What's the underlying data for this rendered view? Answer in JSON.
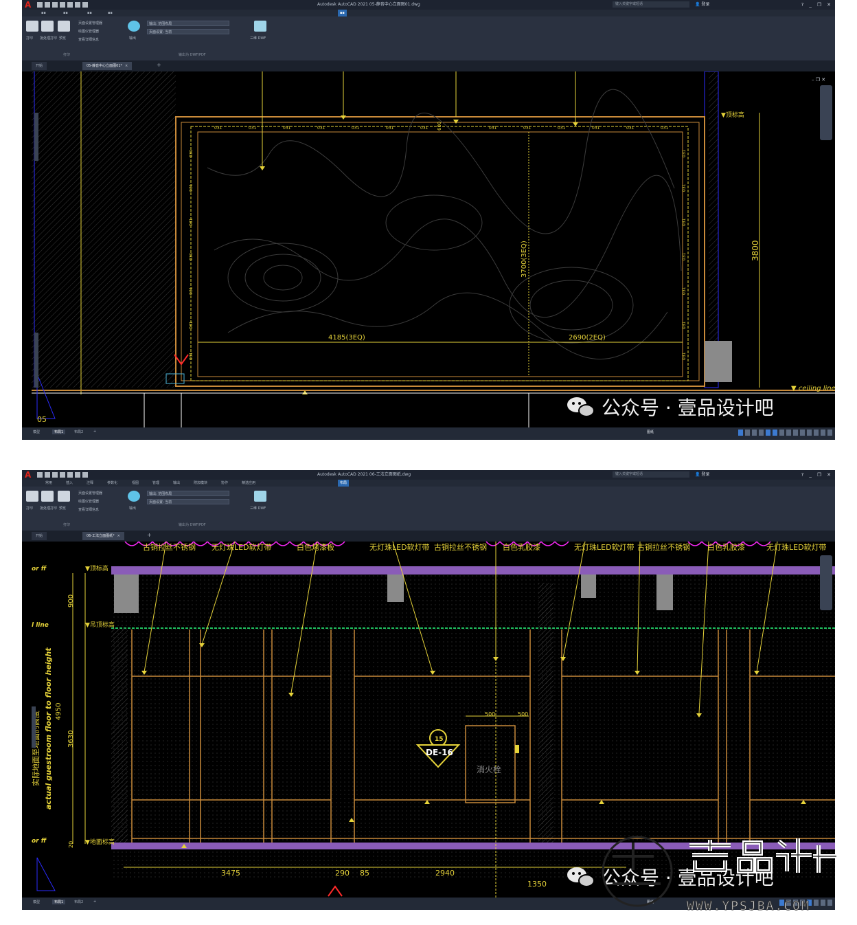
{
  "screens": [
    {
      "app_title": "Autodesk AutoCAD 2021",
      "file_name": "05-静音中心立面图01.dwg",
      "search_placeholder": "键入关键字或短语",
      "login_label": "登录",
      "ribbon": {
        "plot": "打印",
        "batch_plot": "批处理打印",
        "preview": "预览",
        "page_setup_manager": "页面设置管理器",
        "plotter_manager": "绘图仪管理器",
        "view_details": "查看详细信息",
        "group_plot": "打印",
        "export": "输出",
        "export_value": "输出: 范围布局",
        "page_setup_value": "页面设置: 当前",
        "export_group": "输出为 DWF/PDF",
        "dwf_3d": "三维 DWF"
      },
      "doc_tabs": [
        "开始",
        "05-静音中心立面图01*"
      ],
      "status_tabs": [
        "模型",
        "布局1",
        "布局2"
      ],
      "status_model_label": "图纸",
      "drawing": {
        "dim_label_a": "4185(3EQ)",
        "dim_label_b": "2690(2EQ)",
        "dim_label_height": "3700(3EQ)",
        "dim_total_height": "3800",
        "spacing_label": "600",
        "bay_count": "05",
        "ceiling_line_label": "ceiling line",
        "level_label": "▼顶标高"
      },
      "watermark": "公众号 · 壹品设计吧"
    },
    {
      "app_title": "Autodesk AutoCAD 2021",
      "file_name": "06-工法立面图纸.dwg",
      "search_placeholder": "键入关键字或短语",
      "login_label": "登录",
      "menu_items": [
        "常用",
        "插入",
        "注释",
        "参数化",
        "视图",
        "管理",
        "输出",
        "附加模块",
        "协作",
        "精选应用",
        "布局"
      ],
      "ribbon": {
        "plot": "打印",
        "batch_plot": "批处理打印",
        "preview": "预览",
        "page_setup_manager": "页面设置管理器",
        "plotter_manager": "绘图仪管理器",
        "view_details": "查看详细信息",
        "group_plot": "打印",
        "export": "输出",
        "export_value": "输出: 范围布局",
        "page_setup_value": "页面设置: 当前",
        "export_group": "输出为 DWF/PDF",
        "dwf_3d": "三维 DWF"
      },
      "doc_tabs": [
        "开始",
        "06-工法立面图纸*"
      ],
      "status_tabs": [
        "模型",
        "布局1",
        "布局2"
      ],
      "status_model_label": "图纸",
      "drawing": {
        "material_labels": [
          "古铜拉丝不锈钢",
          "无灯珠LED软灯带",
          "白色烤漆板",
          "无灯珠LED软灯带",
          "古铜拉丝不锈钢",
          "白色乳胶漆",
          "无灯珠LED软灯带",
          "古铜拉丝不锈钢",
          "白色乳胶漆",
          "无灯珠LED软灯带"
        ],
        "left_note_cn": "实际地面至地面的高度",
        "left_note_en": "actual guestroom floor to floor height",
        "dim_900": "900",
        "dim_3630": "3630",
        "dim_4950": "4950",
        "dim_20": "20",
        "bottom_dims": [
          "3475",
          "290",
          "85",
          "2940",
          "1350"
        ],
        "top_dims": [
          "500",
          "500"
        ],
        "callout_number": "15",
        "callout_code": "DE-16",
        "box_label": "消火栓",
        "level_labels": [
          "▼顶标高",
          "▼吊顶标高",
          "▼地面标高"
        ],
        "left_level_tags": [
          "or ff",
          "l line",
          "or ff"
        ]
      },
      "watermark": "公众号 · 壹品设计吧"
    }
  ],
  "stamp": {
    "brand": "壹品设计",
    "url": "WWW.YPSJBA.COM"
  },
  "colors": {
    "cad_bg": "#000000",
    "ribbon_bg": "#2a3140",
    "title_bg": "#1d2330",
    "dim_yellow": "#e6d33a",
    "frame_orange": "#c98a3a",
    "cloud_magenta": "#ff2aff",
    "slab_violet": "#8a5cb8"
  }
}
